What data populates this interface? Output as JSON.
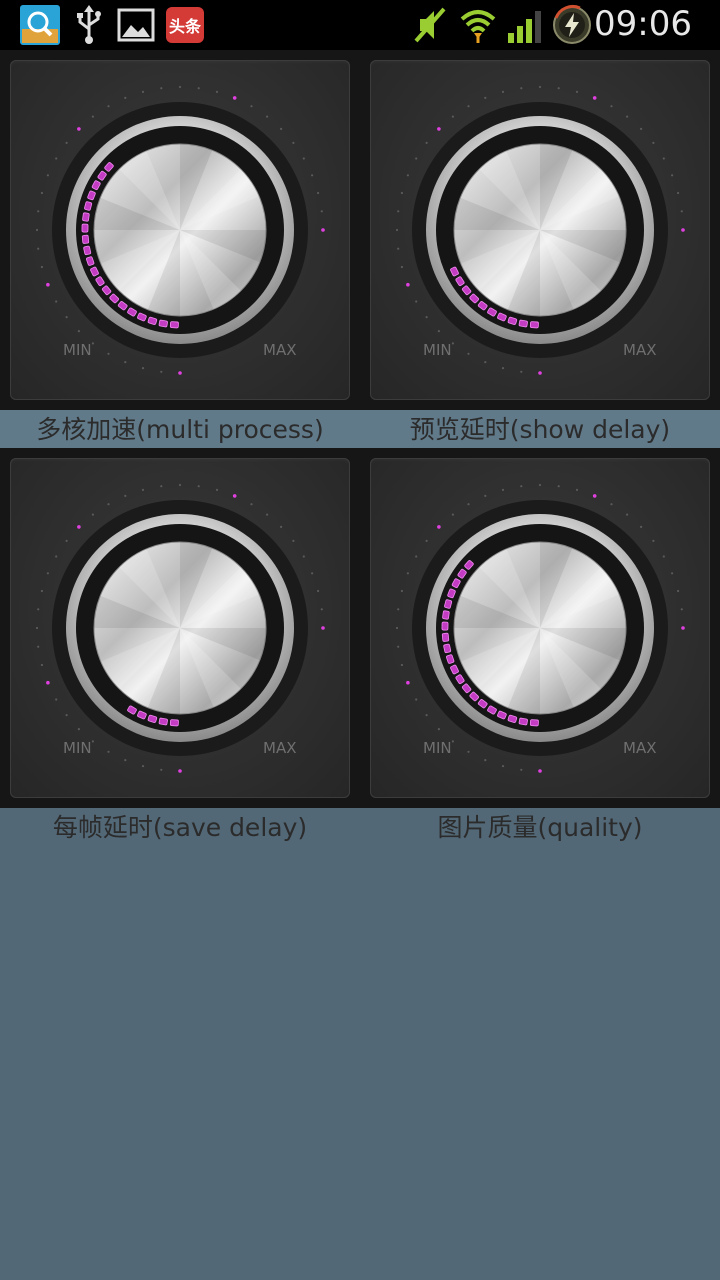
{
  "status_bar": {
    "time": "09:06",
    "left_icons": [
      "magnifier-app-icon",
      "usb-icon",
      "gallery-icon",
      "news-app-icon"
    ],
    "news_app_text": "头条",
    "right_icons": [
      "mute-icon",
      "wifi-icon",
      "signal-icon",
      "battery-charging-icon"
    ]
  },
  "knobs": [
    {
      "caption": "多核加速(multi process)",
      "min_label": "MIN",
      "max_label": "MAX",
      "level": 0.5
    },
    {
      "caption": "预览延时(show delay)",
      "min_label": "MIN",
      "max_label": "MAX",
      "level": 0.25
    },
    {
      "caption": "每帧延时(save delay)",
      "min_label": "MIN",
      "max_label": "MAX",
      "level": 0.12
    },
    {
      "caption": "图片质量(quality)",
      "min_label": "MIN",
      "max_label": "MAX",
      "level": 0.5
    }
  ],
  "colors": {
    "background": "#536877",
    "accent": "#e040e0",
    "caption_band": "#617a8a"
  }
}
